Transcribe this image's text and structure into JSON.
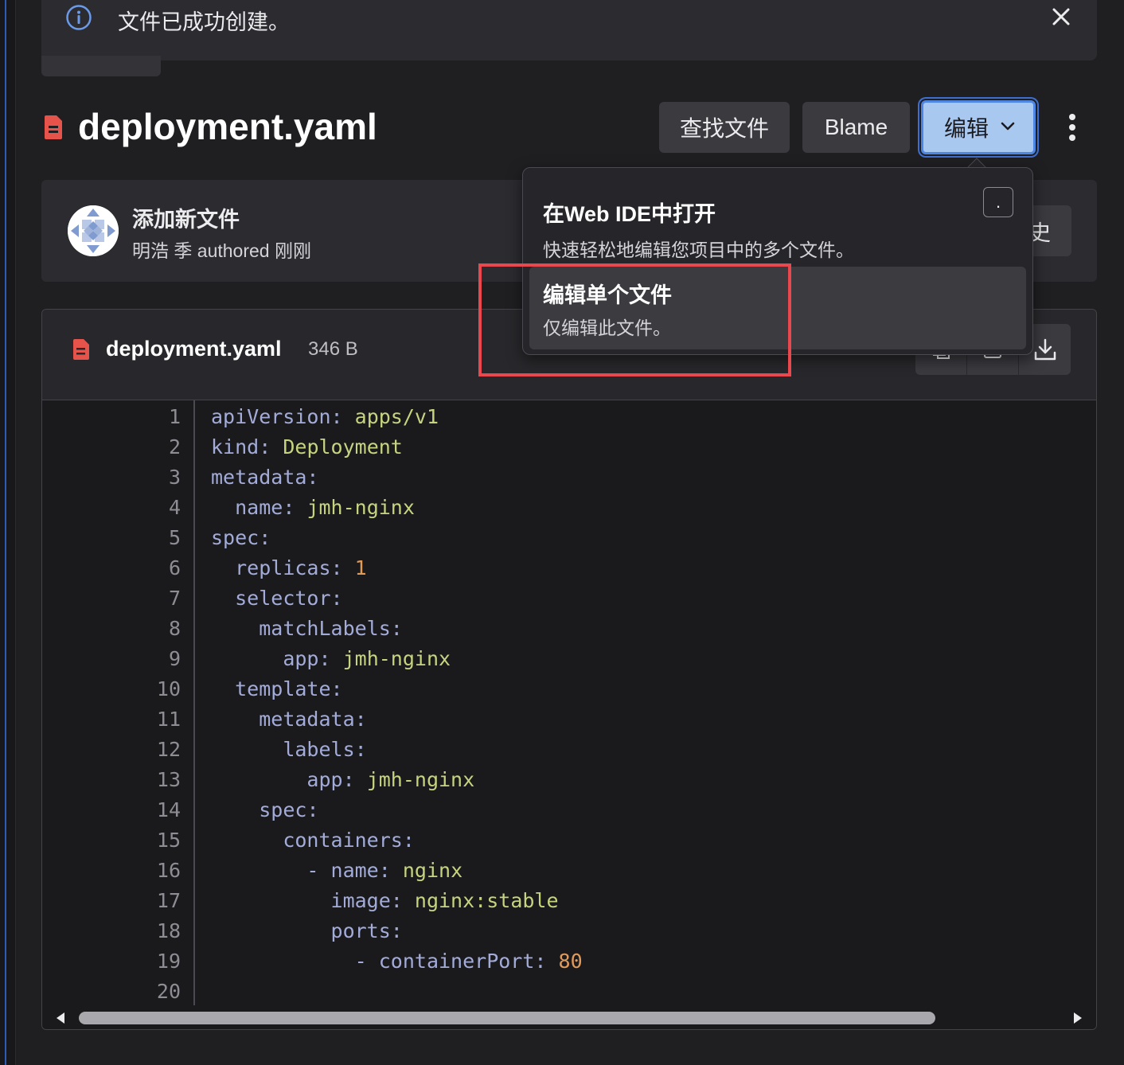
{
  "alert": {
    "message": "文件已成功创建。"
  },
  "header": {
    "filename": "deployment.yaml",
    "buttons": {
      "find_file": "查找文件",
      "blame": "Blame",
      "edit": "编辑"
    }
  },
  "commit": {
    "title": "添加新文件",
    "author": "明浩 季",
    "authored_label": "authored",
    "time": "刚刚",
    "history_partial": "史"
  },
  "dropdown": {
    "items": [
      {
        "title": "在Web IDE中打开",
        "description": "快速轻松地编辑您项目中的多个文件。",
        "shortcut": "."
      },
      {
        "title": "编辑单个文件",
        "description": "仅编辑此文件。"
      }
    ]
  },
  "viewer": {
    "filename": "deployment.yaml",
    "size": "346 B"
  },
  "code": {
    "line_numbers": [
      "1",
      "2",
      "3",
      "4",
      "5",
      "6",
      "7",
      "8",
      "9",
      "10",
      "11",
      "12",
      "13",
      "14",
      "15",
      "16",
      "17",
      "18",
      "19",
      "20"
    ],
    "lines": [
      "apiVersion: apps/v1",
      "kind: Deployment",
      "metadata:",
      "  name: jmh-nginx",
      "spec:",
      "  replicas: 1",
      "  selector:",
      "    matchLabels:",
      "      app: jmh-nginx",
      "  template:",
      "    metadata:",
      "      labels:",
      "        app: jmh-nginx",
      "    spec:",
      "      containers:",
      "        - name: nginx",
      "          image: nginx:stable",
      "          ports:",
      "            - containerPort: 80",
      ""
    ]
  },
  "colors": {
    "accent": "#4d86e3",
    "edit_button_bg": "#a9c8ef",
    "highlight": "#e8484e",
    "file_icon": "#e5534b",
    "yaml_key": "#a3acd9",
    "yaml_string": "#c7d47f",
    "yaml_number": "#e09a5a"
  },
  "icons": [
    "info-icon",
    "close-icon",
    "file-icon",
    "chevron-down-icon",
    "kebab-icon",
    "avatar-identicon",
    "copy-icon",
    "raw-icon",
    "download-icon",
    "arrow-left-icon",
    "arrow-right-icon"
  ]
}
